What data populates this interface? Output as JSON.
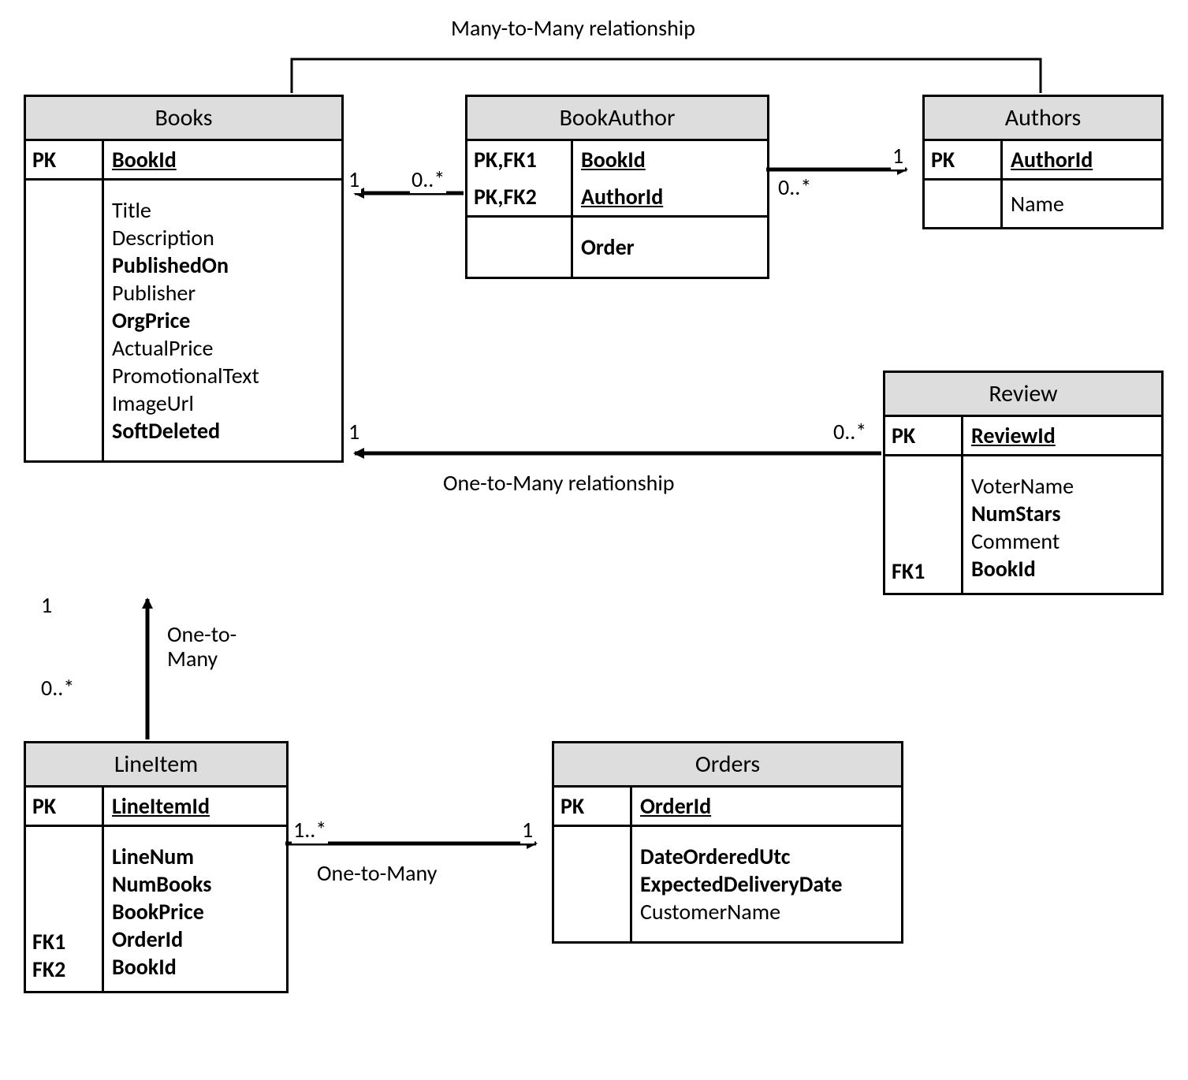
{
  "relationship_labels": {
    "many_to_many": "Many-to-Many relationship",
    "one_to_many_review": "One-to-Many relationship",
    "one_to_many_lineitem": "One-to-\nMany",
    "one_to_many_orders": "One-to-Many"
  },
  "cardinalities": {
    "books_bookauthor_left": "1",
    "books_bookauthor_right": "0..*",
    "bookauthor_authors_left": "0..*",
    "bookauthor_authors_right": "1",
    "books_review_left": "1",
    "books_review_right": "0..*",
    "books_lineitem_top": "1",
    "books_lineitem_bottom": "0..*",
    "lineitem_orders_left": "1..*",
    "lineitem_orders_right": "1"
  },
  "entities": {
    "books": {
      "title": "Books",
      "pk_key": "PK",
      "pk_val": "BookId",
      "attrs": [
        {
          "key": "",
          "val": "Title",
          "bold": false
        },
        {
          "key": "",
          "val": "Description",
          "bold": false
        },
        {
          "key": "",
          "val": "PublishedOn",
          "bold": true
        },
        {
          "key": "",
          "val": "Publisher",
          "bold": false
        },
        {
          "key": "",
          "val": "OrgPrice",
          "bold": true
        },
        {
          "key": "",
          "val": "ActualPrice",
          "bold": false
        },
        {
          "key": "",
          "val": "PromotionalText",
          "bold": false
        },
        {
          "key": "",
          "val": "ImageUrl",
          "bold": false
        },
        {
          "key": "",
          "val": "SoftDeleted",
          "bold": true
        }
      ]
    },
    "bookauthor": {
      "title": "BookAuthor",
      "pk1_key": "PK,FK1",
      "pk1_val": "BookId",
      "pk2_key": "PK,FK2",
      "pk2_val": "AuthorId",
      "attr_key": "",
      "attr_val": "Order"
    },
    "authors": {
      "title": "Authors",
      "pk_key": "PK",
      "pk_val": "AuthorId",
      "attr_key": "",
      "attr_val": "Name"
    },
    "review": {
      "title": "Review",
      "pk_key": "PK",
      "pk_val": "ReviewId",
      "attrs": [
        {
          "key": "",
          "val": "VoterName",
          "bold": false
        },
        {
          "key": "",
          "val": "NumStars",
          "bold": true
        },
        {
          "key": "",
          "val": "Comment",
          "bold": false
        },
        {
          "key": "FK1",
          "val": "BookId",
          "bold": true
        }
      ]
    },
    "lineitem": {
      "title": "LineItem",
      "pk_key": "PK",
      "pk_val": "LineItemId",
      "attrs": [
        {
          "key": "",
          "val": "LineNum",
          "bold": true
        },
        {
          "key": "",
          "val": "NumBooks",
          "bold": true
        },
        {
          "key": "",
          "val": "BookPrice",
          "bold": true
        },
        {
          "key": "FK1",
          "val": "OrderId",
          "bold": true
        },
        {
          "key": "FK2",
          "val": "BookId",
          "bold": true
        }
      ]
    },
    "orders": {
      "title": "Orders",
      "pk_key": "PK",
      "pk_val": "OrderId",
      "attrs": [
        {
          "key": "",
          "val": "DateOrderedUtc",
          "bold": true
        },
        {
          "key": "",
          "val": "ExpectedDeliveryDate",
          "bold": true
        },
        {
          "key": "",
          "val": "CustomerName",
          "bold": false
        }
      ]
    }
  }
}
